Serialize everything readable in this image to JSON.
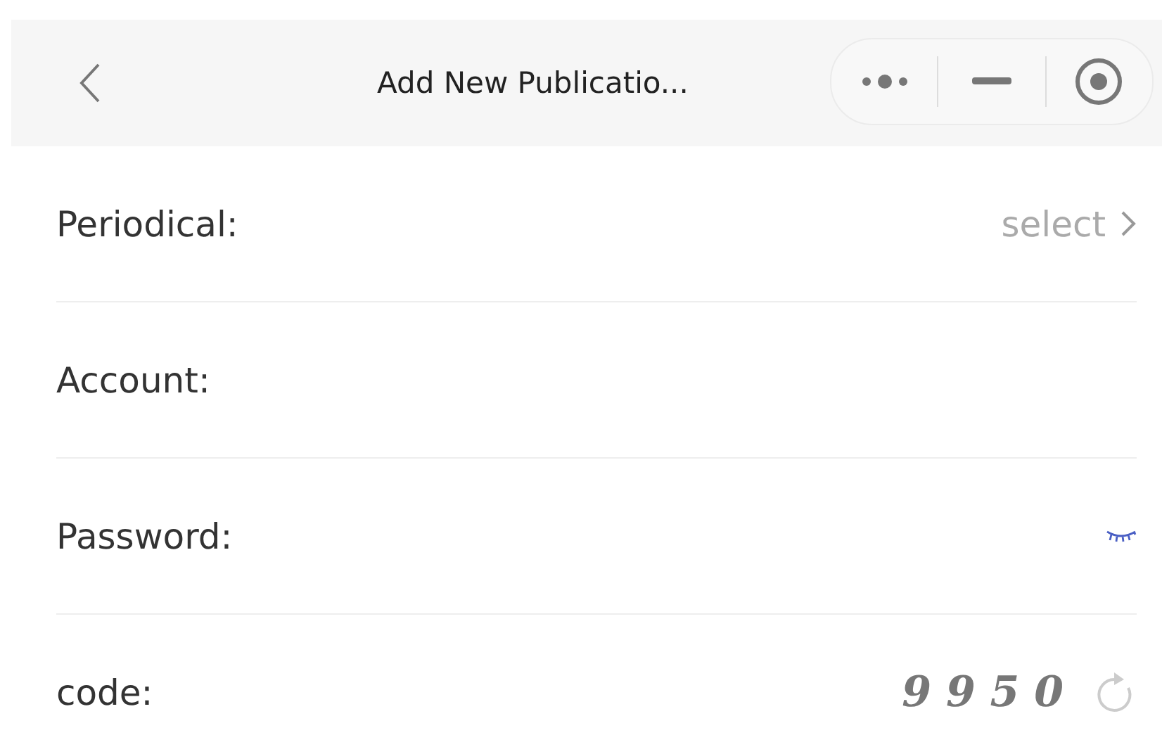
{
  "header": {
    "title": "Add New Publicatio..."
  },
  "fields": [
    {
      "kind": "select",
      "label": "Periodical:",
      "placeholder": "select"
    },
    {
      "kind": "text",
      "label": "Account:"
    },
    {
      "kind": "password",
      "label": "Password:"
    },
    {
      "kind": "captcha",
      "label": "code:",
      "captcha": "9 9 5 0"
    }
  ]
}
